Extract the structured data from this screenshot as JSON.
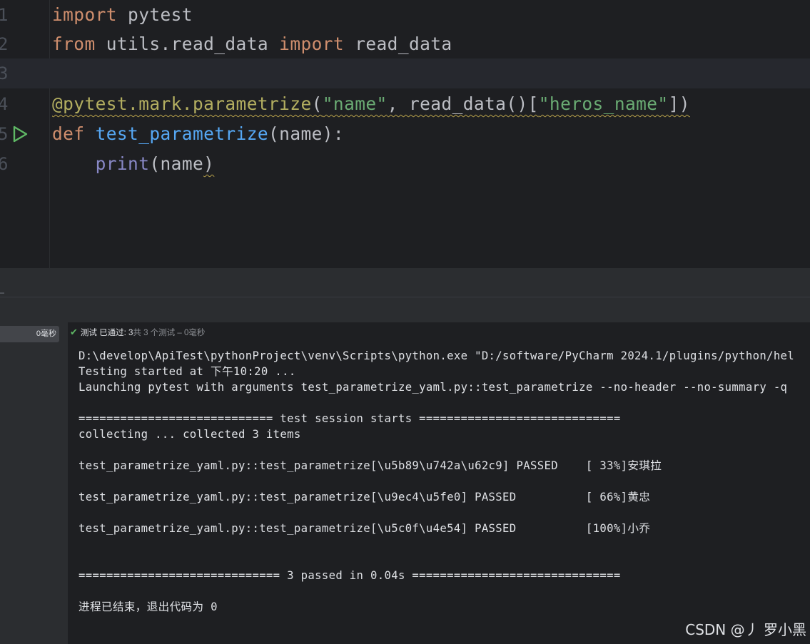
{
  "editor": {
    "lines": [
      {
        "num": "1",
        "tokens": [
          {
            "t": "import",
            "c": "kw"
          },
          {
            "t": " pytest",
            "c": "plain"
          }
        ]
      },
      {
        "num": "2",
        "tokens": [
          {
            "t": "from",
            "c": "kw"
          },
          {
            "t": " utils.read_data ",
            "c": "plain"
          },
          {
            "t": "import",
            "c": "kw"
          },
          {
            "t": " read_data",
            "c": "plain"
          }
        ]
      },
      {
        "num": "3",
        "tokens": []
      },
      {
        "num": "4",
        "tokens": [
          {
            "t": "@pytest.mark.parametrize",
            "c": "dec squig"
          },
          {
            "t": "(",
            "c": "plain squig"
          },
          {
            "t": "\"name\"",
            "c": "str squig"
          },
          {
            "t": ", read_data()[",
            "c": "plain squig"
          },
          {
            "t": "\"heros_name\"",
            "c": "str squig"
          },
          {
            "t": "])",
            "c": "plain squig"
          }
        ]
      },
      {
        "num": "5",
        "tokens": [
          {
            "t": "def",
            "c": "kw"
          },
          {
            "t": " ",
            "c": "plain"
          },
          {
            "t": "test_parametrize",
            "c": "fn"
          },
          {
            "t": "(name):",
            "c": "plain"
          }
        ]
      },
      {
        "num": "6",
        "tokens": [
          {
            "t": "    ",
            "c": "plain"
          },
          {
            "t": "print",
            "c": "bi"
          },
          {
            "t": "(name",
            "c": "plain"
          },
          {
            "t": ")",
            "c": "plain squig"
          }
        ]
      }
    ]
  },
  "run_panel": {
    "tree_time": "0毫秒",
    "status": {
      "prefix": "测试 已通过: 3",
      "suffix": "共 3 个测试 – 0毫秒"
    },
    "output": [
      "D:\\develop\\ApiTest\\pythonProject\\venv\\Scripts\\python.exe \"D:/software/PyCharm 2024.1/plugins/python/hel",
      "Testing started at 下午10:20 ...",
      "Launching pytest with arguments test_parametrize_yaml.py::test_parametrize --no-header --no-summary -q",
      "",
      "============================ test session starts =============================",
      "collecting ... collected 3 items",
      "",
      "test_parametrize_yaml.py::test_parametrize[\\u5b89\\u742a\\u62c9] PASSED    [ 33%]安琪拉",
      "",
      "test_parametrize_yaml.py::test_parametrize[\\u9ec4\\u5fe0] PASSED          [ 66%]黄忠",
      "",
      "test_parametrize_yaml.py::test_parametrize[\\u5c0f\\u4e54] PASSED          [100%]小乔",
      "",
      "",
      "============================= 3 passed in 0.04s ==============================",
      "",
      "进程已结束，退出代码为 0"
    ]
  },
  "watermark": "CSDN @丿 罗小黑",
  "icons": {
    "run": "run-gutter-icon",
    "status": "check-icon"
  },
  "colors": {
    "keyword": "#cf8e6d",
    "function": "#56a8f5",
    "decorator": "#b3ae60",
    "string": "#6aab73",
    "builtin": "#8888c6",
    "pass_check": "#5fb865"
  }
}
